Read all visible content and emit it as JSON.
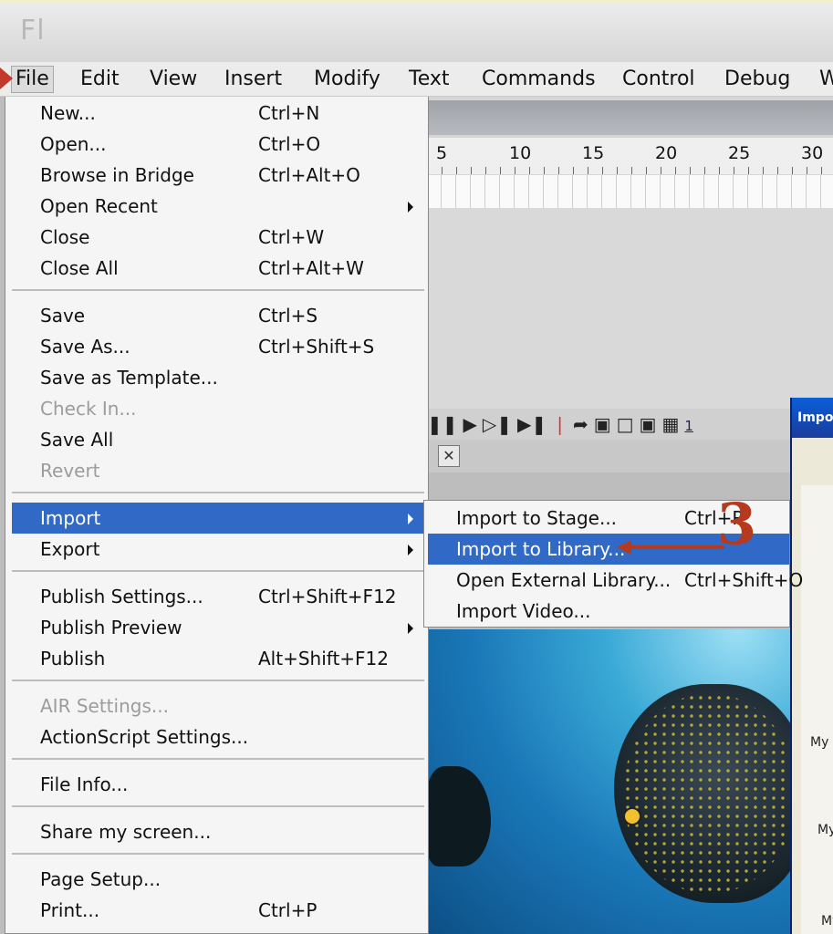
{
  "app": {
    "logo": "Fl"
  },
  "menubar": {
    "items": [
      "File",
      "Edit",
      "View",
      "Insert",
      "Modify",
      "Text",
      "Commands",
      "Control",
      "Debug",
      "W"
    ]
  },
  "timeline": {
    "ruler": [
      "5",
      "10",
      "15",
      "20",
      "25",
      "30"
    ],
    "frame_indicator": "1"
  },
  "file_menu": {
    "items": [
      {
        "label": "New...",
        "shortcut": "Ctrl+N"
      },
      {
        "label": "Open...",
        "shortcut": "Ctrl+O"
      },
      {
        "label": "Browse in Bridge",
        "shortcut": "Ctrl+Alt+O"
      },
      {
        "label": "Open Recent",
        "shortcut": ""
      },
      {
        "label": "Close",
        "shortcut": "Ctrl+W"
      },
      {
        "label": "Close All",
        "shortcut": "Ctrl+Alt+W"
      },
      {
        "label": "Save",
        "shortcut": "Ctrl+S"
      },
      {
        "label": "Save As...",
        "shortcut": "Ctrl+Shift+S"
      },
      {
        "label": "Save as Template...",
        "shortcut": ""
      },
      {
        "label": "Check In...",
        "shortcut": ""
      },
      {
        "label": "Save All",
        "shortcut": ""
      },
      {
        "label": "Revert",
        "shortcut": ""
      },
      {
        "label": "Import",
        "shortcut": ""
      },
      {
        "label": "Export",
        "shortcut": ""
      },
      {
        "label": "Publish Settings...",
        "shortcut": "Ctrl+Shift+F12"
      },
      {
        "label": "Publish Preview",
        "shortcut": ""
      },
      {
        "label": "Publish",
        "shortcut": "Alt+Shift+F12"
      },
      {
        "label": "AIR Settings...",
        "shortcut": ""
      },
      {
        "label": "ActionScript Settings...",
        "shortcut": ""
      },
      {
        "label": "File Info...",
        "shortcut": ""
      },
      {
        "label": "Share my screen...",
        "shortcut": ""
      },
      {
        "label": "Page Setup...",
        "shortcut": ""
      },
      {
        "label": "Print...",
        "shortcut": "Ctrl+P"
      }
    ]
  },
  "import_submenu": {
    "items": [
      {
        "label": "Import to Stage...",
        "shortcut": "Ctrl+R"
      },
      {
        "label": "Import to Library...",
        "shortcut": ""
      },
      {
        "label": "Open External Library...",
        "shortcut": "Ctrl+Shift+O"
      },
      {
        "label": "Import Video...",
        "shortcut": ""
      }
    ]
  },
  "annotation": {
    "step": "3",
    "color": "#b53a1e"
  },
  "dialog": {
    "title": "Import",
    "labels": [
      "My",
      "My",
      "My"
    ]
  },
  "colors": {
    "highlight": "#3169c6",
    "disabled": "#9c9c9c"
  }
}
